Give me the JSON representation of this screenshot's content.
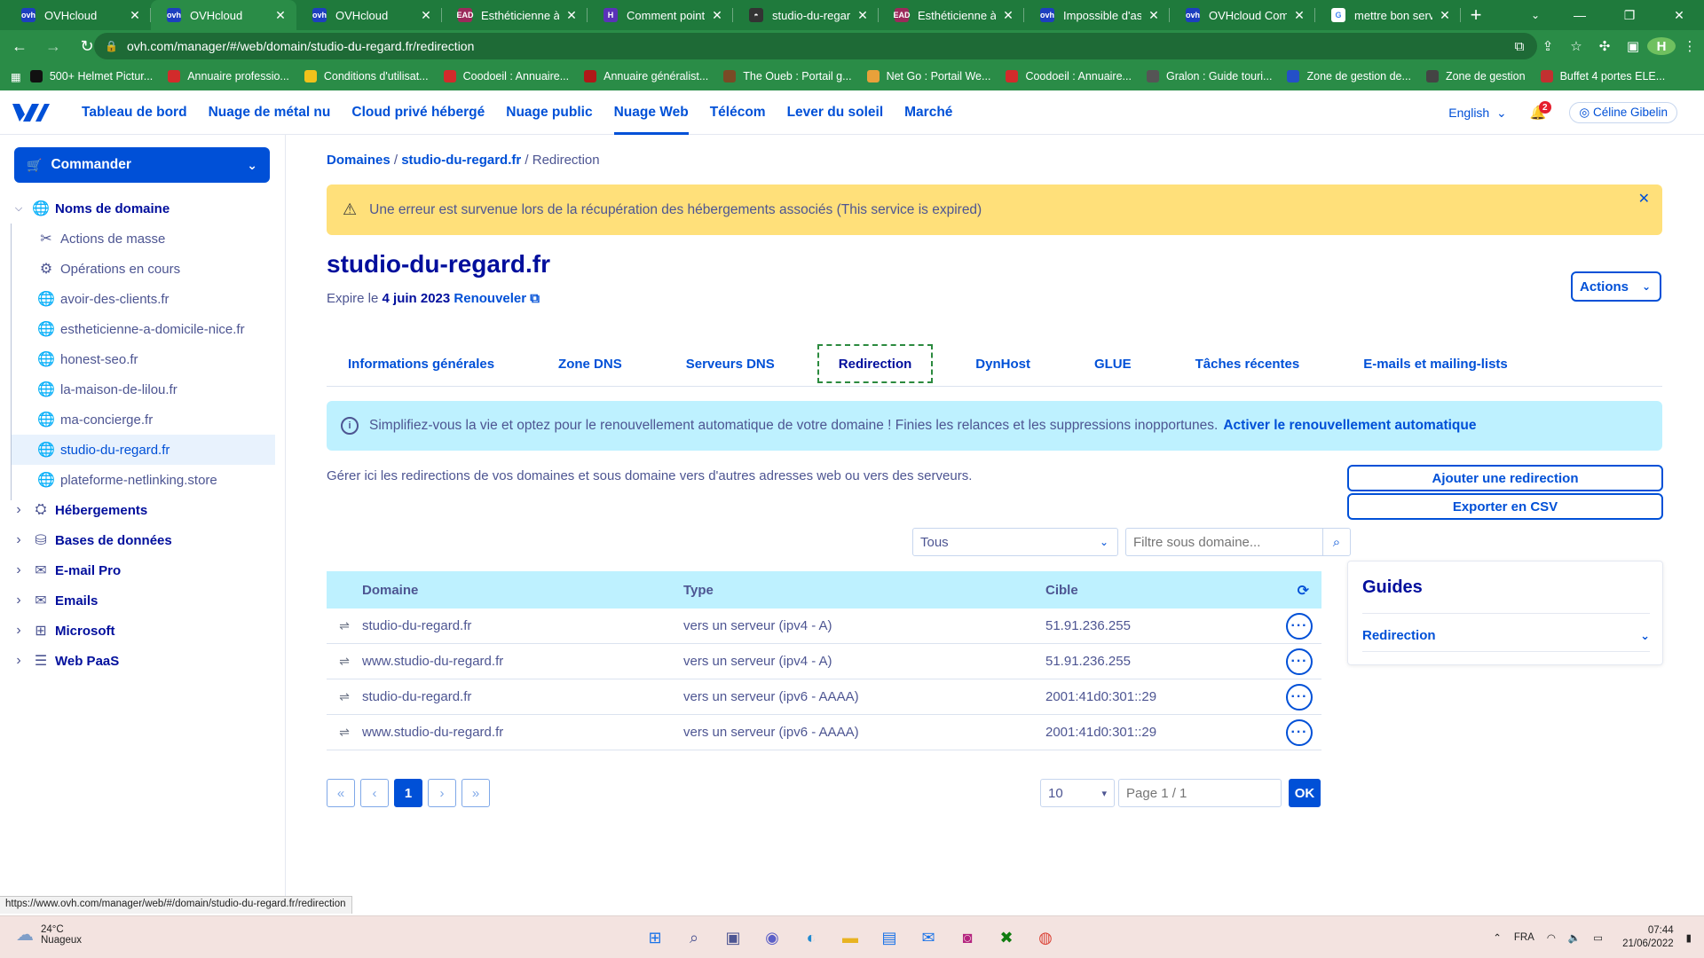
{
  "browser": {
    "tabs": [
      {
        "title": "OVHcloud",
        "fav_color": "#1d3fbf",
        "fav_text": "ovh"
      },
      {
        "title": "OVHcloud",
        "fav_color": "#1d3fbf",
        "fav_text": "ovh",
        "active": true
      },
      {
        "title": "OVHcloud",
        "fav_color": "#1d3fbf",
        "fav_text": "ovh"
      },
      {
        "title": "Esthéticienne à do",
        "fav_color": "#9b2a5b",
        "fav_text": "EAD"
      },
      {
        "title": "Comment pointer",
        "fav_color": "#5a32b8",
        "fav_text": "H"
      },
      {
        "title": "studio-du-regard.f",
        "fav_color": "#333333",
        "fav_text": "◓"
      },
      {
        "title": "Esthéticienne à do",
        "fav_color": "#9b2a5b",
        "fav_text": "EAD"
      },
      {
        "title": "Impossible d'assoc",
        "fav_color": "#1d3fbf",
        "fav_text": "ovh"
      },
      {
        "title": "OVHcloud Commu",
        "fav_color": "#1d3fbf",
        "fav_text": "ovh"
      },
      {
        "title": "mettre bon server",
        "fav_color": "#ffffff",
        "fav_text": "G"
      }
    ],
    "url": "ovh.com/manager/#/web/domain/studio-du-regard.fr/redirection",
    "profile_initial": "H",
    "bookmarks": [
      {
        "label": "500+ Helmet Pictur...",
        "color": "#111111"
      },
      {
        "label": "Annuaire professio...",
        "color": "#d22b2b"
      },
      {
        "label": "Conditions d'utilisat...",
        "color": "#f2c21b"
      },
      {
        "label": "Coodoeil : Annuaire...",
        "color": "#d22b2b"
      },
      {
        "label": "Annuaire généralist...",
        "color": "#b01818"
      },
      {
        "label": "The Oueb : Portail g...",
        "color": "#7a4a25"
      },
      {
        "label": "Net Go : Portail We...",
        "color": "#e8a13a"
      },
      {
        "label": "Coodoeil : Annuaire...",
        "color": "#d22b2b"
      },
      {
        "label": "Gralon : Guide touri...",
        "color": "#555555"
      },
      {
        "label": "Zone de gestion de...",
        "color": "#2450c8"
      },
      {
        "label": "Zone de gestion",
        "color": "#444444"
      },
      {
        "label": "Buffet 4 portes ELE...",
        "color": "#c23030"
      }
    ],
    "status_url": "https://www.ovh.com/manager/web/#/domain/studio-du-regard.fr/redirection"
  },
  "topnav": {
    "links": [
      "Tableau de bord",
      "Nuage de métal nu",
      "Cloud privé hébergé",
      "Nuage public",
      "Nuage Web",
      "Télécom",
      "Lever du soleil",
      "Marché"
    ],
    "active_index": 4,
    "language": "English",
    "notifications": "2",
    "user": "Céline Gibelin"
  },
  "sidebar": {
    "order_button": "Commander",
    "domains_label": "Noms de domaine",
    "domain_items": [
      {
        "label": "Actions de masse",
        "icon": "scissors-icon"
      },
      {
        "label": "Opérations en cours",
        "icon": "gear-icon"
      },
      {
        "label": "avoir-des-clients.fr",
        "icon": "globe-icon"
      },
      {
        "label": "estheticienne-a-domicile-nice.fr",
        "icon": "globe-icon"
      },
      {
        "label": "honest-seo.fr",
        "icon": "globe-icon"
      },
      {
        "label": "la-maison-de-lilou.fr",
        "icon": "globe-icon"
      },
      {
        "label": "ma-concierge.fr",
        "icon": "globe-icon"
      },
      {
        "label": "studio-du-regard.fr",
        "icon": "globe-icon",
        "selected": true
      },
      {
        "label": "plateforme-netlinking.store",
        "icon": "globe-icon"
      }
    ],
    "sections": [
      {
        "label": "Hébergements",
        "icon": "hosting-icon"
      },
      {
        "label": "Bases de données",
        "icon": "database-icon"
      },
      {
        "label": "E-mail Pro",
        "icon": "mail-icon"
      },
      {
        "label": "Emails",
        "icon": "mail-icon"
      },
      {
        "label": "Microsoft",
        "icon": "windows-icon"
      },
      {
        "label": "Web PaaS",
        "icon": "paas-icon"
      }
    ]
  },
  "breadcrumb": {
    "root": "Domaines",
    "domain": "studio-du-regard.fr",
    "current": "Redirection"
  },
  "warning": "Une erreur est survenue lors de la récupération des hébergements associés (This service is expired)",
  "page": {
    "title": "studio-du-regard.fr",
    "expire_prefix": "Expire le",
    "expire_date": "4 juin 2023",
    "renew_link": "Renouveler",
    "actions_button": "Actions"
  },
  "tabs": [
    "Informations générales",
    "Zone DNS",
    "Serveurs DNS",
    "Redirection",
    "DynHost",
    "GLUE",
    "Tâches récentes",
    "E-mails et mailing-lists"
  ],
  "active_tab": 3,
  "info_banner": {
    "text": "Simplifiez-vous la vie et optez pour le renouvellement automatique de votre domaine ! Finies les relances et les suppressions inopportunes.",
    "link": "Activer le renouvellement automatique"
  },
  "description": "Gérer ici les redirections de vos domaines et sous domaine vers d'autres adresses web ou vers des serveurs.",
  "buttons": {
    "add": "Ajouter une redirection",
    "export": "Exporter en CSV"
  },
  "filters": {
    "type_selected": "Tous",
    "subdomain_placeholder": "Filtre sous domaine..."
  },
  "table": {
    "headers": [
      "Domaine",
      "Type",
      "Cible"
    ],
    "rows": [
      {
        "domain": "studio-du-regard.fr",
        "type": "vers un serveur (ipv4 - A)",
        "target": "51.91.236.255"
      },
      {
        "domain": "www.studio-du-regard.fr",
        "type": "vers un serveur (ipv4 - A)",
        "target": "51.91.236.255"
      },
      {
        "domain": "studio-du-regard.fr",
        "type": "vers un serveur (ipv6 - AAAA)",
        "target": "2001:41d0:301::29"
      },
      {
        "domain": "www.studio-du-regard.fr",
        "type": "vers un serveur (ipv6 - AAAA)",
        "target": "2001:41d0:301::29"
      }
    ]
  },
  "pagination": {
    "current": "1",
    "per_page": "10",
    "page_placeholder": "Page 1 / 1",
    "ok": "OK"
  },
  "guides": {
    "title": "Guides",
    "item": "Redirection"
  },
  "taskbar": {
    "temperature": "24°C",
    "weather": "Nuageux",
    "language": "FRA",
    "time": "07:44",
    "date": "21/06/2022"
  },
  "colors": {
    "accent": "#0050d7",
    "heading": "#000e9c",
    "warning_bg": "#ffe07a",
    "info_bg": "#bef1ff",
    "browser_green": "#2a8c47"
  }
}
